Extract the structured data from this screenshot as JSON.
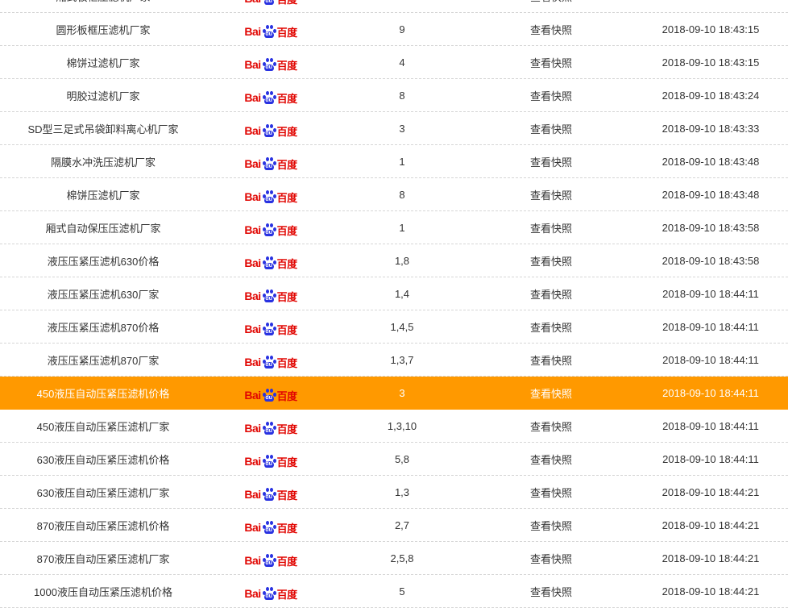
{
  "engine": {
    "logo_left": "Bai",
    "logo_mid": "du",
    "logo_right": "百度"
  },
  "rows": [
    {
      "keyword": "厢式板框压滤机厂家",
      "rank": "",
      "snapshot": "查看快照",
      "time": ""
    },
    {
      "keyword": "圆形板框压滤机厂家",
      "rank": "9",
      "snapshot": "查看快照",
      "time": "2018-09-10 18:43:15"
    },
    {
      "keyword": "棉饼过滤机厂家",
      "rank": "4",
      "snapshot": "查看快照",
      "time": "2018-09-10 18:43:15"
    },
    {
      "keyword": "明胶过滤机厂家",
      "rank": "8",
      "snapshot": "查看快照",
      "time": "2018-09-10 18:43:24"
    },
    {
      "keyword": "SD型三足式吊袋卸料离心机厂家",
      "rank": "3",
      "snapshot": "查看快照",
      "time": "2018-09-10 18:43:33"
    },
    {
      "keyword": "隔膜水冲洗压滤机厂家",
      "rank": "1",
      "snapshot": "查看快照",
      "time": "2018-09-10 18:43:48"
    },
    {
      "keyword": "棉饼压滤机厂家",
      "rank": "8",
      "snapshot": "查看快照",
      "time": "2018-09-10 18:43:48"
    },
    {
      "keyword": "厢式自动保压压滤机厂家",
      "rank": "1",
      "snapshot": "查看快照",
      "time": "2018-09-10 18:43:58"
    },
    {
      "keyword": "液压压紧压滤机630价格",
      "rank": "1,8",
      "snapshot": "查看快照",
      "time": "2018-09-10 18:43:58"
    },
    {
      "keyword": "液压压紧压滤机630厂家",
      "rank": "1,4",
      "snapshot": "查看快照",
      "time": "2018-09-10 18:44:11"
    },
    {
      "keyword": "液压压紧压滤机870价格",
      "rank": "1,4,5",
      "snapshot": "查看快照",
      "time": "2018-09-10 18:44:11"
    },
    {
      "keyword": "液压压紧压滤机870厂家",
      "rank": "1,3,7",
      "snapshot": "查看快照",
      "time": "2018-09-10 18:44:11"
    },
    {
      "keyword": "450液压自动压紧压滤机价格",
      "rank": "3",
      "snapshot": "查看快照",
      "time": "2018-09-10 18:44:11"
    },
    {
      "keyword": "450液压自动压紧压滤机厂家",
      "rank": "1,3,10",
      "snapshot": "查看快照",
      "time": "2018-09-10 18:44:11"
    },
    {
      "keyword": "630液压自动压紧压滤机价格",
      "rank": "5,8",
      "snapshot": "查看快照",
      "time": "2018-09-10 18:44:11"
    },
    {
      "keyword": "630液压自动压紧压滤机厂家",
      "rank": "1,3",
      "snapshot": "查看快照",
      "time": "2018-09-10 18:44:21"
    },
    {
      "keyword": "870液压自动压紧压滤机价格",
      "rank": "2,7",
      "snapshot": "查看快照",
      "time": "2018-09-10 18:44:21"
    },
    {
      "keyword": "870液压自动压紧压滤机厂家",
      "rank": "2,5,8",
      "snapshot": "查看快照",
      "time": "2018-09-10 18:44:21"
    },
    {
      "keyword": "1000液压自动压紧压滤机价格",
      "rank": "5",
      "snapshot": "查看快照",
      "time": "2018-09-10 18:44:21"
    }
  ],
  "highlight_index": 12,
  "colors": {
    "highlight": "#ff9900",
    "logo_red": "#e10602",
    "logo_blue": "#2932e1"
  }
}
